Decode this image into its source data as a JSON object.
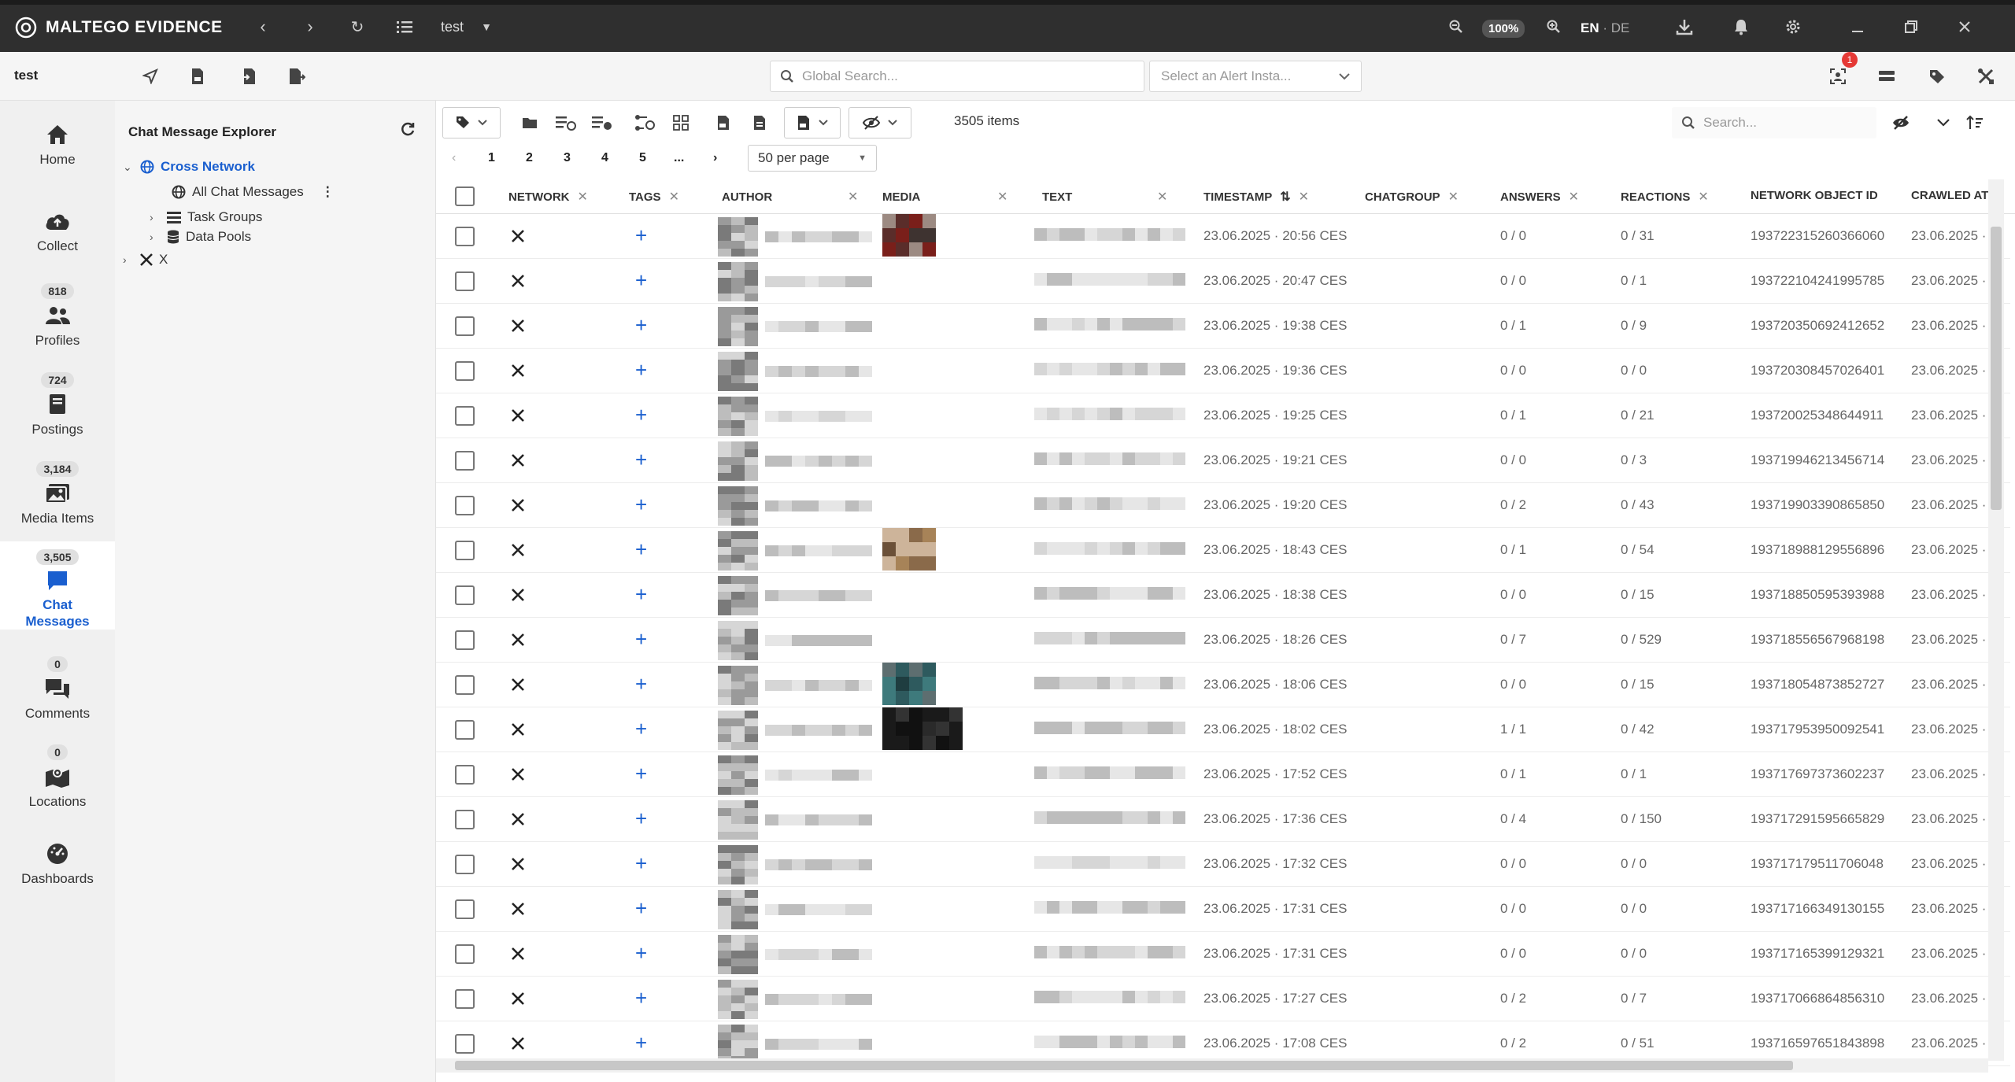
{
  "app": {
    "title": "MALTEGO EVIDENCE",
    "project": "test",
    "zoom": "100%",
    "lang_active": "EN",
    "lang_sep": "·",
    "lang_other": "DE"
  },
  "toolbar": {
    "project_name": "test",
    "global_search_placeholder": "Global Search...",
    "alert_select_placeholder": "Select an Alert Insta...",
    "notification_count": "1"
  },
  "nav": [
    {
      "label": "Home",
      "count": "",
      "icon": "home-icon"
    },
    {
      "label": "Collect",
      "count": "",
      "icon": "cloud-upload-icon"
    },
    {
      "label": "Profiles",
      "count": "818",
      "icon": "people-icon"
    },
    {
      "label": "Postings",
      "count": "724",
      "icon": "book-icon"
    },
    {
      "label": "Media Items",
      "count": "3,184",
      "icon": "images-icon"
    },
    {
      "label": "Chat Messages",
      "count": "3,505",
      "icon": "chat-icon"
    },
    {
      "label": "Comments",
      "count": "0",
      "icon": "comments-icon"
    },
    {
      "label": "Locations",
      "count": "0",
      "icon": "map-icon"
    },
    {
      "label": "Dashboards",
      "count": "",
      "icon": "dashboard-icon"
    }
  ],
  "explorer": {
    "title": "Chat Message Explorer",
    "tree": {
      "cross_network": "Cross Network",
      "all_chat_messages": "All Chat Messages",
      "task_groups": "Task Groups",
      "data_pools": "Data Pools",
      "x": "X"
    }
  },
  "grid": {
    "items_count": "3505 items",
    "search_placeholder": "Search...",
    "pages": [
      "1",
      "2",
      "3",
      "4",
      "5",
      "..."
    ],
    "per_page": "50 per page",
    "columns": [
      "NETWORK",
      "TAGS",
      "AUTHOR",
      "MEDIA",
      "TEXT",
      "TIMESTAMP",
      "CHATGROUP",
      "ANSWERS",
      "REACTIONS",
      "NETWORK OBJECT ID",
      "CRAWLED AT"
    ],
    "rows": [
      {
        "network": "X",
        "tags": "+",
        "timestamp": "23.06.2025 · 20:56 CES",
        "answers": "0 / 0",
        "reactions": "0 / 31",
        "object_id": "193722315260366060",
        "crawled": "23.06.2025 ·",
        "media": "red"
      },
      {
        "network": "X",
        "tags": "+",
        "timestamp": "23.06.2025 · 20:47 CES",
        "answers": "0 / 0",
        "reactions": "0 / 1",
        "object_id": "193722104241995785",
        "crawled": "23.06.2025 ·",
        "media": ""
      },
      {
        "network": "X",
        "tags": "+",
        "timestamp": "23.06.2025 · 19:38 CES",
        "answers": "0 / 1",
        "reactions": "0 / 9",
        "object_id": "193720350692412652",
        "crawled": "23.06.2025 ·",
        "media": ""
      },
      {
        "network": "X",
        "tags": "+",
        "timestamp": "23.06.2025 · 19:36 CES",
        "answers": "0 / 0",
        "reactions": "0 / 0",
        "object_id": "193720308457026401",
        "crawled": "23.06.2025 ·",
        "media": ""
      },
      {
        "network": "X",
        "tags": "+",
        "timestamp": "23.06.2025 · 19:25 CES",
        "answers": "0 / 1",
        "reactions": "0 / 21",
        "object_id": "193720025348644911",
        "crawled": "23.06.2025 ·",
        "media": ""
      },
      {
        "network": "X",
        "tags": "+",
        "timestamp": "23.06.2025 · 19:21 CES",
        "answers": "0 / 0",
        "reactions": "0 / 3",
        "object_id": "193719946213456714",
        "crawled": "23.06.2025 ·",
        "media": ""
      },
      {
        "network": "X",
        "tags": "+",
        "timestamp": "23.06.2025 · 19:20 CES",
        "answers": "0 / 2",
        "reactions": "0 / 43",
        "object_id": "193719903390865850",
        "crawled": "23.06.2025 ·",
        "media": ""
      },
      {
        "network": "X",
        "tags": "+",
        "timestamp": "23.06.2025 · 18:43 CES",
        "answers": "0 / 1",
        "reactions": "0 / 54",
        "object_id": "193718988129556896",
        "crawled": "23.06.2025 ·",
        "media": "brown"
      },
      {
        "network": "X",
        "tags": "+",
        "timestamp": "23.06.2025 · 18:38 CES",
        "answers": "0 / 0",
        "reactions": "0 / 15",
        "object_id": "193718850595393988",
        "crawled": "23.06.2025 ·",
        "media": ""
      },
      {
        "network": "X",
        "tags": "+",
        "timestamp": "23.06.2025 · 18:26 CES",
        "answers": "0 / 7",
        "reactions": "0 / 529",
        "object_id": "193718556567968198",
        "crawled": "23.06.2025 ·",
        "media": ""
      },
      {
        "network": "X",
        "tags": "+",
        "timestamp": "23.06.2025 · 18:06 CES",
        "answers": "0 / 0",
        "reactions": "0 / 15",
        "object_id": "193718054873852727",
        "crawled": "23.06.2025 ·",
        "media": "teal"
      },
      {
        "network": "X",
        "tags": "+",
        "timestamp": "23.06.2025 · 18:02 CES",
        "answers": "1 / 1",
        "reactions": "0 / 42",
        "object_id": "193717953950092541",
        "crawled": "23.06.2025 ·",
        "media": "dark"
      },
      {
        "network": "X",
        "tags": "+",
        "timestamp": "23.06.2025 · 17:52 CES",
        "answers": "0 / 1",
        "reactions": "0 / 1",
        "object_id": "193717697373602237",
        "crawled": "23.06.2025 ·",
        "media": ""
      },
      {
        "network": "X",
        "tags": "+",
        "timestamp": "23.06.2025 · 17:36 CES",
        "answers": "0 / 4",
        "reactions": "0 / 150",
        "object_id": "193717291595665829",
        "crawled": "23.06.2025 ·",
        "media": ""
      },
      {
        "network": "X",
        "tags": "+",
        "timestamp": "23.06.2025 · 17:32 CES",
        "answers": "0 / 0",
        "reactions": "0 / 0",
        "object_id": "193717179511706048",
        "crawled": "23.06.2025 ·",
        "media": ""
      },
      {
        "network": "X",
        "tags": "+",
        "timestamp": "23.06.2025 · 17:31 CES",
        "answers": "0 / 0",
        "reactions": "0 / 0",
        "object_id": "193717166349130155",
        "crawled": "23.06.2025 ·",
        "media": ""
      },
      {
        "network": "X",
        "tags": "+",
        "timestamp": "23.06.2025 · 17:31 CES",
        "answers": "0 / 0",
        "reactions": "0 / 0",
        "object_id": "193717165399129321",
        "crawled": "23.06.2025 ·",
        "media": ""
      },
      {
        "network": "X",
        "tags": "+",
        "timestamp": "23.06.2025 · 17:27 CES",
        "answers": "0 / 2",
        "reactions": "0 / 7",
        "object_id": "193717066864856310",
        "crawled": "23.06.2025 ·",
        "media": ""
      },
      {
        "network": "X",
        "tags": "+",
        "timestamp": "23.06.2025 · 17:08 CES",
        "answers": "0 / 2",
        "reactions": "0 / 51",
        "object_id": "193716597651843898",
        "crawled": "23.06.2025 ·",
        "media": ""
      }
    ]
  },
  "colors": {
    "accent": "#1a5fcf",
    "titlebar": "#2f2f2f",
    "badge": "#e53935"
  }
}
